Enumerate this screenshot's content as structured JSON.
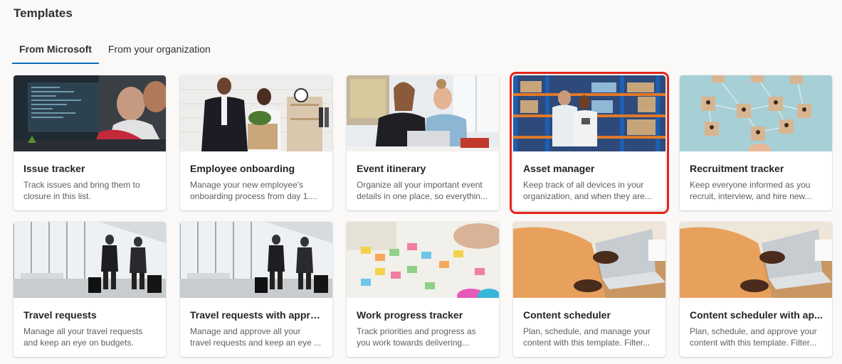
{
  "page": {
    "title": "Templates"
  },
  "tabs": [
    {
      "label": "From Microsoft",
      "active": true
    },
    {
      "label": "From your organization",
      "active": false
    }
  ],
  "accent_color": "#0f6cbd",
  "highlight_color": "#e5241a",
  "cards": [
    {
      "title": "Issue tracker",
      "description": "Track issues and bring them to closure in this list.",
      "image": "people-coding-photo"
    },
    {
      "title": "Employee onboarding",
      "description": "Manage your new employee's onboarding process from day 1....",
      "image": "office-handshake-photo"
    },
    {
      "title": "Event itinerary",
      "description": "Organize all your important event details in one place, so everythin...",
      "image": "women-laptop-photo"
    },
    {
      "title": "Asset manager",
      "description": "Keep track of all devices in your organization, and when they are...",
      "image": "warehouse-photo",
      "highlighted": true
    },
    {
      "title": "Recruitment tracker",
      "description": "Keep everyone informed as you recruit, interview, and hire new...",
      "image": "network-blocks-photo"
    },
    {
      "title": "Travel requests",
      "description": "Manage all your travel requests and keep an eye on budgets.",
      "image": "airport-travelers-photo"
    },
    {
      "title": "Travel requests with approv...",
      "description": "Manage and approve all your travel requests and keep an eye ...",
      "image": "airport-travelers-photo"
    },
    {
      "title": "Work progress tracker",
      "description": "Track priorities and progress as you work towards delivering...",
      "image": "sticky-notes-photo"
    },
    {
      "title": "Content scheduler",
      "description": "Plan, schedule, and manage your content with this template. Filter...",
      "image": "laptop-typing-photo"
    },
    {
      "title": "Content scheduler with ap...",
      "description": "Plan, schedule, and approve your content with this template. Filter...",
      "image": "laptop-typing-photo"
    }
  ]
}
